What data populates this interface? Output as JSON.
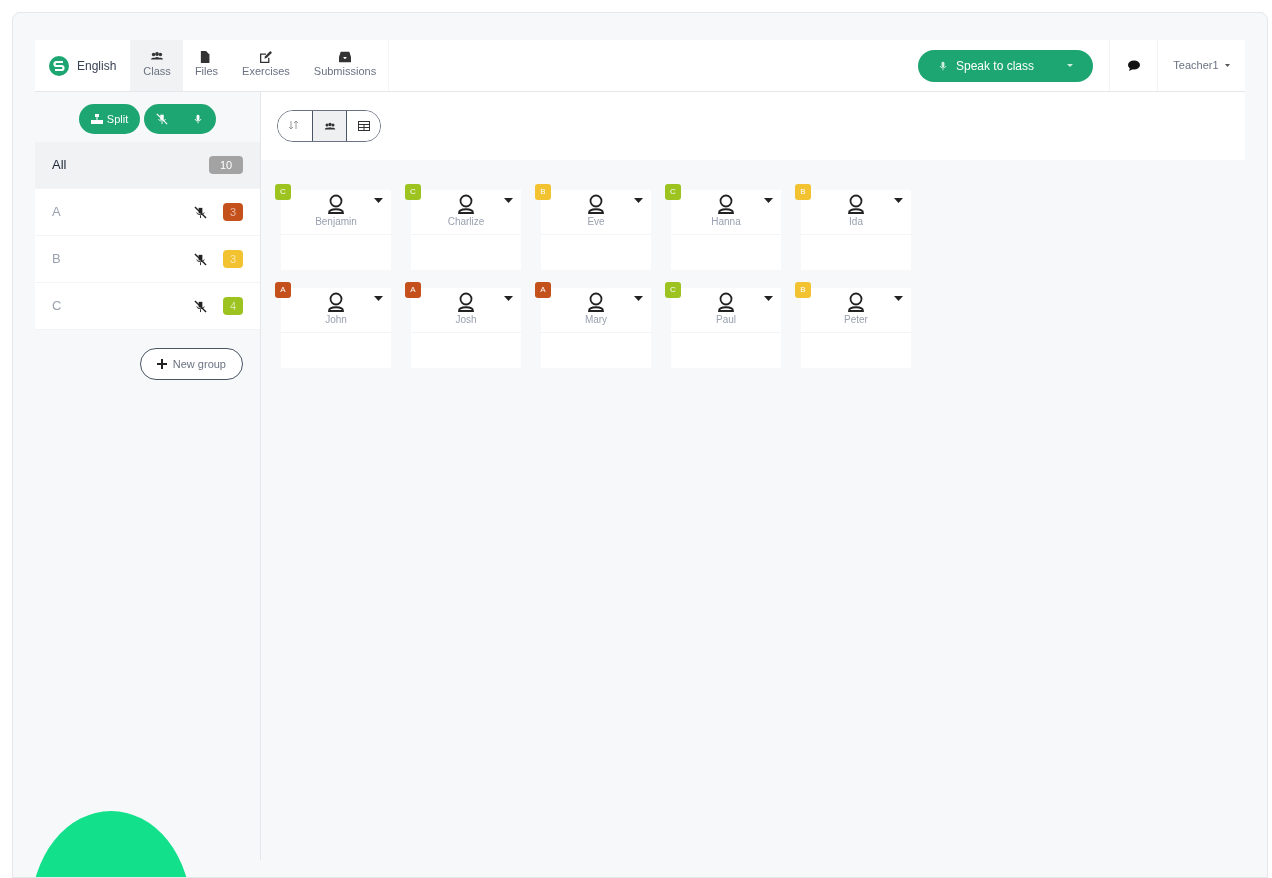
{
  "brand": {
    "label": "English"
  },
  "tabs": [
    {
      "label": "Class",
      "selected": true
    },
    {
      "label": "Files",
      "selected": false
    },
    {
      "label": "Exercises",
      "selected": false
    },
    {
      "label": "Submissions",
      "selected": false
    }
  ],
  "speak_button": {
    "label": "Speak to class"
  },
  "user_menu": {
    "label": "Teacher1"
  },
  "sidebar": {
    "split_button": {
      "label": "Split"
    },
    "groups": [
      {
        "name": "All",
        "count": "10",
        "color": "#a3a3a3",
        "selected": true,
        "muted": false
      },
      {
        "name": "A",
        "count": "3",
        "color": "#c4511b",
        "selected": false,
        "muted": true
      },
      {
        "name": "B",
        "count": "3",
        "color": "#f2c230",
        "selected": false,
        "muted": true
      },
      {
        "name": "C",
        "count": "4",
        "color": "#9cc31f",
        "selected": false,
        "muted": true
      }
    ],
    "new_group_button": {
      "label": "New group"
    }
  },
  "view_toggles": [
    {
      "kind": "sort",
      "selected": false
    },
    {
      "kind": "groups",
      "selected": true
    },
    {
      "kind": "table",
      "selected": false
    }
  ],
  "students": [
    {
      "name": "Benjamin",
      "group": "C",
      "color": "#9cc31f"
    },
    {
      "name": "Charlize",
      "group": "C",
      "color": "#9cc31f"
    },
    {
      "name": "Eve",
      "group": "B",
      "color": "#f2c230"
    },
    {
      "name": "Hanna",
      "group": "C",
      "color": "#9cc31f"
    },
    {
      "name": "Ida",
      "group": "B",
      "color": "#f2c230"
    },
    {
      "name": "John",
      "group": "A",
      "color": "#c4511b"
    },
    {
      "name": "Josh",
      "group": "A",
      "color": "#c4511b"
    },
    {
      "name": "Mary",
      "group": "A",
      "color": "#c4511b"
    },
    {
      "name": "Paul",
      "group": "C",
      "color": "#9cc31f"
    },
    {
      "name": "Peter",
      "group": "B",
      "color": "#f2c230"
    }
  ]
}
